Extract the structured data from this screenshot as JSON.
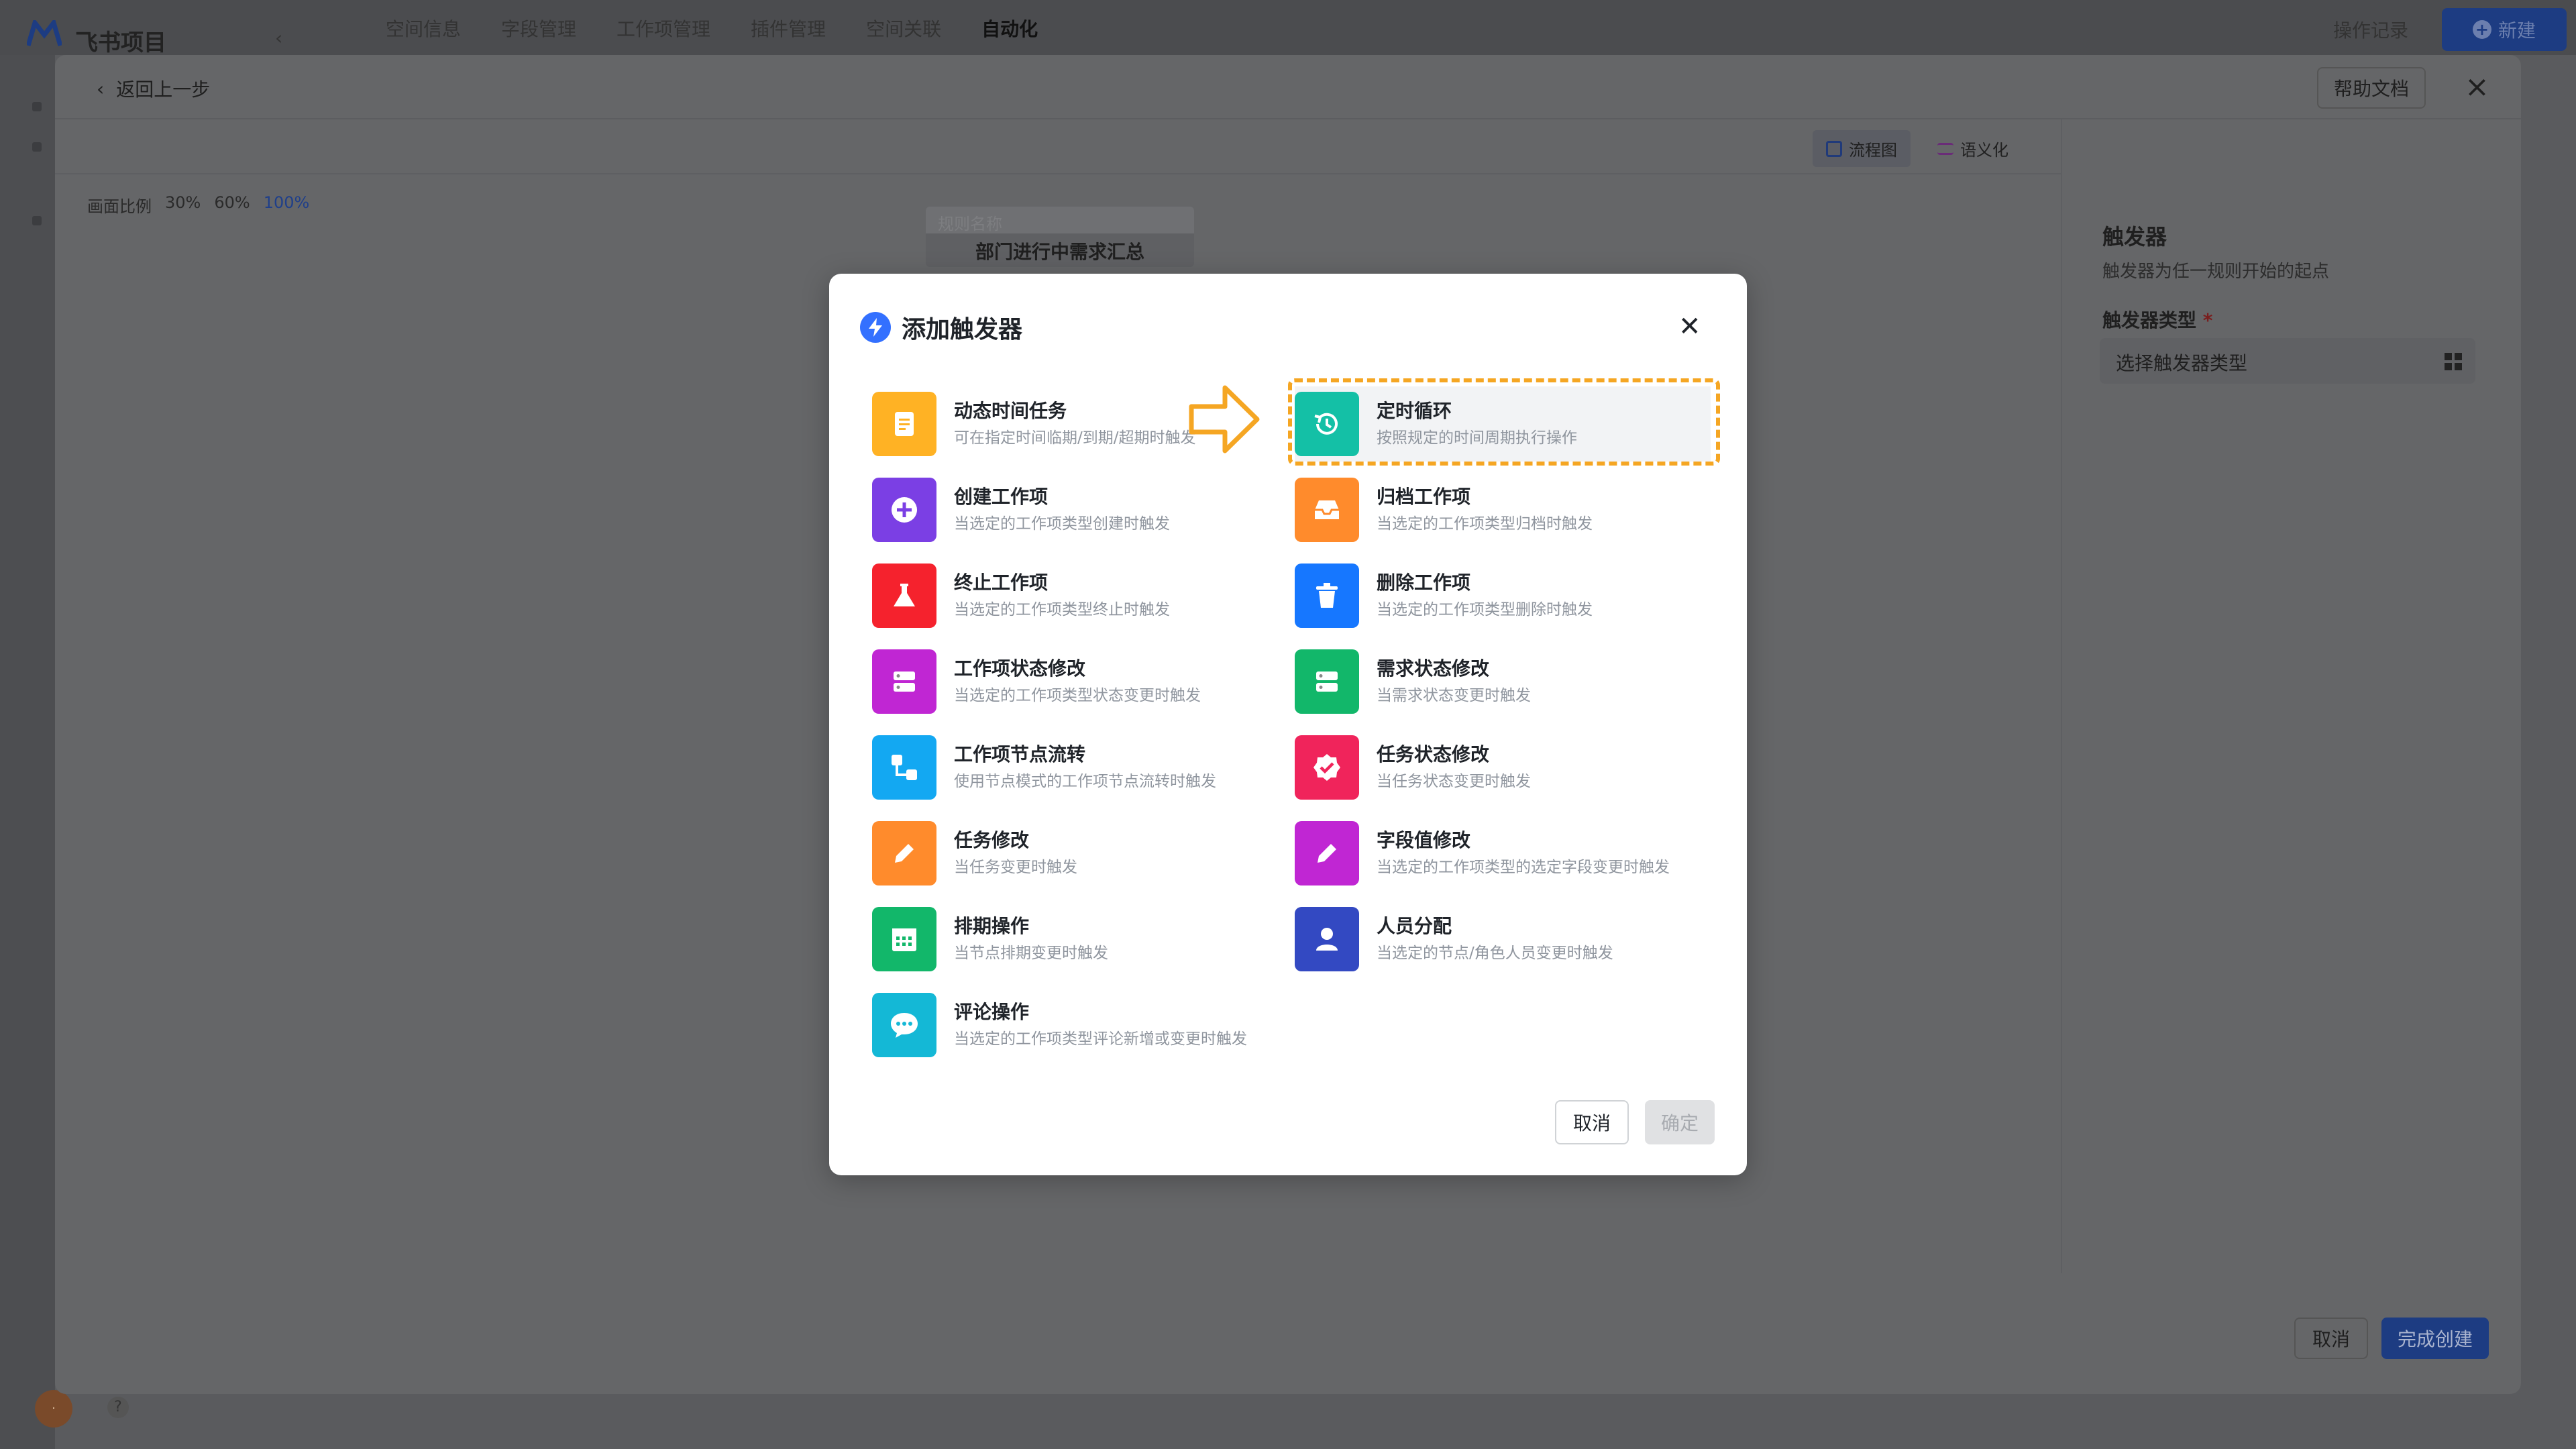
{
  "app": {
    "name": "飞书项目",
    "nav": [
      "空间信息",
      "字段管理",
      "工作项管理",
      "插件管理",
      "空间关联",
      "自动化"
    ],
    "nav_active_index": 5,
    "op_log": "操作记录",
    "new_button": "新建"
  },
  "panel": {
    "back_label": "返回上一步",
    "help_doc": "帮助文档",
    "view_tabs": [
      "流程图",
      "语义化"
    ],
    "ratio_label": "画面比例",
    "ratio_options": [
      "30%",
      "60%",
      "100%"
    ],
    "ratio_selected": "100%",
    "node_header": "规则名称",
    "node_title": "部门进行中需求汇总",
    "right": {
      "title": "触发器",
      "desc": "触发器为任一规则开始的起点",
      "type_label": "触发器类型",
      "required_mark": "*",
      "type_placeholder": "选择触发器类型"
    },
    "cancel": "取消",
    "done": "完成创建"
  },
  "modal": {
    "title": "添加触发器",
    "cancel": "取消",
    "confirm": "确定",
    "triggers": [
      {
        "name": "动态时间任务",
        "desc": "可在指定时间临期/到期/超期时触发",
        "color": "#ffb224",
        "icon": "document-icon"
      },
      {
        "name": "定时循环",
        "desc": "按照规定的时间周期执行操作",
        "color": "#14c0a6",
        "icon": "history-clock-icon",
        "highlighted": true
      },
      {
        "name": "创建工作项",
        "desc": "当选定的工作项类型创建时触发",
        "color": "#7b3fe4",
        "icon": "plus-circle-icon"
      },
      {
        "name": "归档工作项",
        "desc": "当选定的工作项类型归档时触发",
        "color": "#ff8b2c",
        "icon": "inbox-icon"
      },
      {
        "name": "终止工作项",
        "desc": "当选定的工作项类型终止时触发",
        "color": "#f5222d",
        "icon": "flask-icon"
      },
      {
        "name": "删除工作项",
        "desc": "当选定的工作项类型删除时触发",
        "color": "#1677ff",
        "icon": "trash-icon"
      },
      {
        "name": "工作项状态修改",
        "desc": "当选定的工作项类型状态变更时触发",
        "color": "#c026d3",
        "icon": "server-icon"
      },
      {
        "name": "需求状态修改",
        "desc": "当需求状态变更时触发",
        "color": "#12b76a",
        "icon": "server-icon"
      },
      {
        "name": "工作项节点流转",
        "desc": "使用节点模式的工作项节点流转时触发",
        "color": "#13a8f2",
        "icon": "flow-icon"
      },
      {
        "name": "任务状态修改",
        "desc": "当任务状态变更时触发",
        "color": "#f0245b",
        "icon": "badge-check-icon"
      },
      {
        "name": "任务修改",
        "desc": "当任务变更时触发",
        "color": "#ff8b2c",
        "icon": "pencil-icon"
      },
      {
        "name": "字段值修改",
        "desc": "当选定的工作项类型的选定字段变更时触发",
        "color": "#c026d3",
        "icon": "pencil-icon"
      },
      {
        "name": "排期操作",
        "desc": "当节点排期变更时触发",
        "color": "#12b76a",
        "icon": "calendar-icon"
      },
      {
        "name": "人员分配",
        "desc": "当选定的节点/角色人员变更时触发",
        "color": "#3349c2",
        "icon": "person-icon"
      },
      {
        "name": "评论操作",
        "desc": "当选定的工作项类型评论新增或变更时触发",
        "color": "#14b8d6",
        "icon": "chat-icon"
      }
    ]
  },
  "colors": {
    "accent": "#3370ff",
    "highlight_border": "#f5a623"
  }
}
